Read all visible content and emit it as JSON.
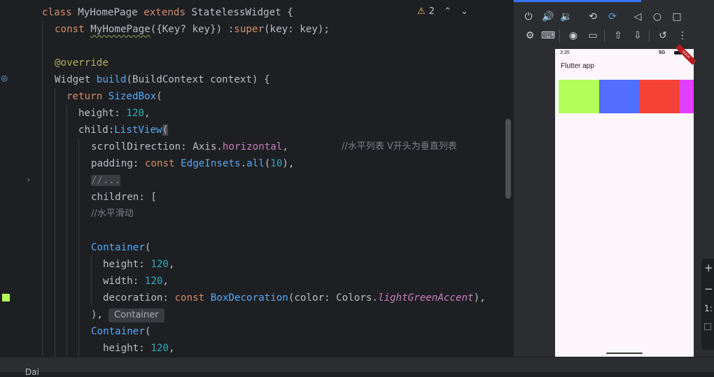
{
  "editor": {
    "warnings": {
      "icon": "warning-icon",
      "count": "2"
    },
    "lines": [
      "class MyHomePage extends StatelessWidget {",
      "const MyHomePage({Key? key}) :super(key: key);",
      "@override",
      "Widget build(BuildContext context) {",
      "return SizedBox(",
      "height: 120,",
      "child:ListView(",
      "scrollDirection: Axis.horizontal,",
      "//水平列表 V开头为垂直列表",
      "padding: const EdgeInsets.all(10),",
      "//...",
      "children: [",
      "//水平滑动",
      "Container(",
      "height: 120,",
      "width: 120,",
      "decoration: const BoxDecoration(color: Colors.lightGreenAccent),",
      "),",
      "Container",
      "Container(",
      "height: 120,"
    ]
  },
  "emulator": {
    "status_time": "3:35",
    "status_network": "5G",
    "debug_banner": "DEBUG",
    "app_title": "Flutter app",
    "boxes": [
      "#b2ff59",
      "#536dfe",
      "#f44336",
      "#e040fb"
    ]
  },
  "bottom": {
    "label": "Dai"
  },
  "side_tools": {
    "plus": "+",
    "minus": "−",
    "ratio": "1:"
  }
}
